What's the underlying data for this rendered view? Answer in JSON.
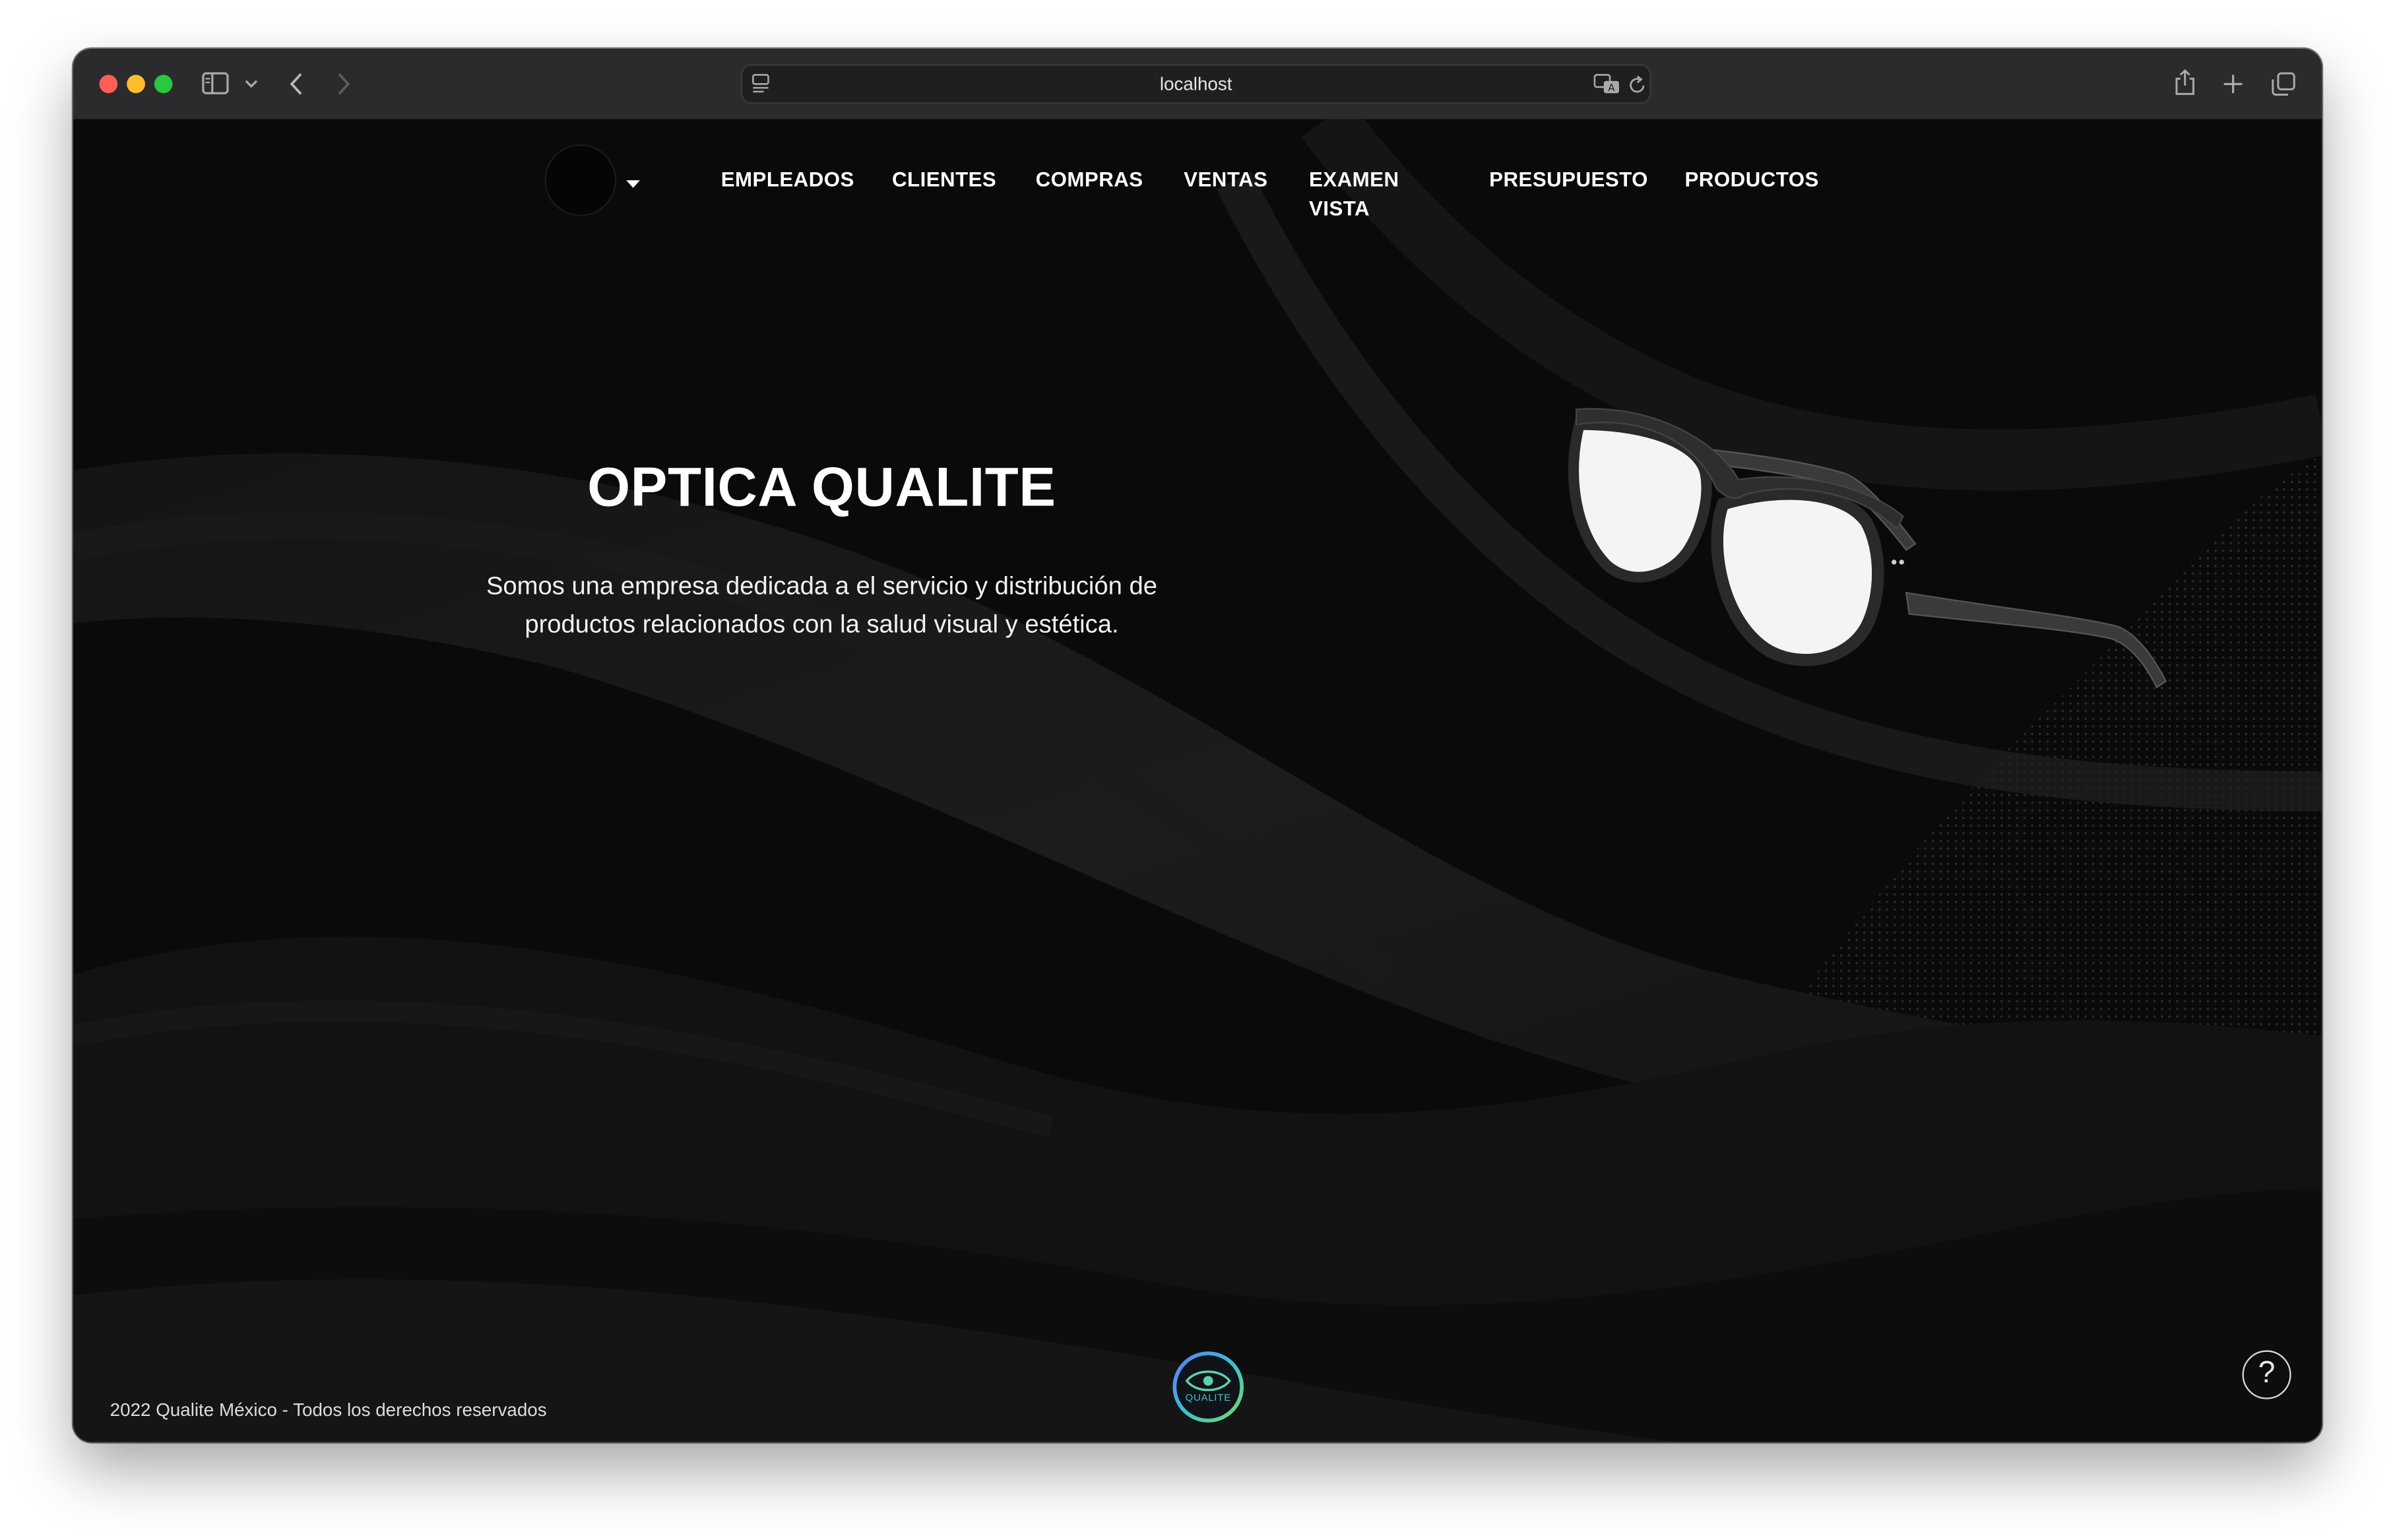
{
  "browser": {
    "url": "localhost",
    "colors": {
      "close": "#ff5f57",
      "minimize": "#febc2e",
      "zoom": "#28c840"
    },
    "icons": [
      "sidebar-icon",
      "chevron-down-icon",
      "back-icon",
      "forward-icon",
      "page-menu-icon",
      "translate-icon",
      "reload-icon",
      "share-icon",
      "new-tab-icon",
      "tab-overview-icon"
    ]
  },
  "nav": {
    "items": [
      {
        "label": "EMPLEADOS"
      },
      {
        "label": "CLIENTES"
      },
      {
        "label": "COMPRAS"
      },
      {
        "label": "VENTAS"
      },
      {
        "label": "EXAMEN VISTA"
      },
      {
        "label": "PRESUPUESTO"
      },
      {
        "label": "PRODUCTOS"
      }
    ]
  },
  "hero": {
    "title": "OPTICA QUALITE",
    "description": "Somos una empresa dedicada a el servicio y distribución de productos relacionados con la salud visual y estética."
  },
  "footer": {
    "copyright": "2022 Qualite México - Todos los derechos reservados",
    "badge_text": "QUALITE",
    "help_glyph": "?"
  }
}
